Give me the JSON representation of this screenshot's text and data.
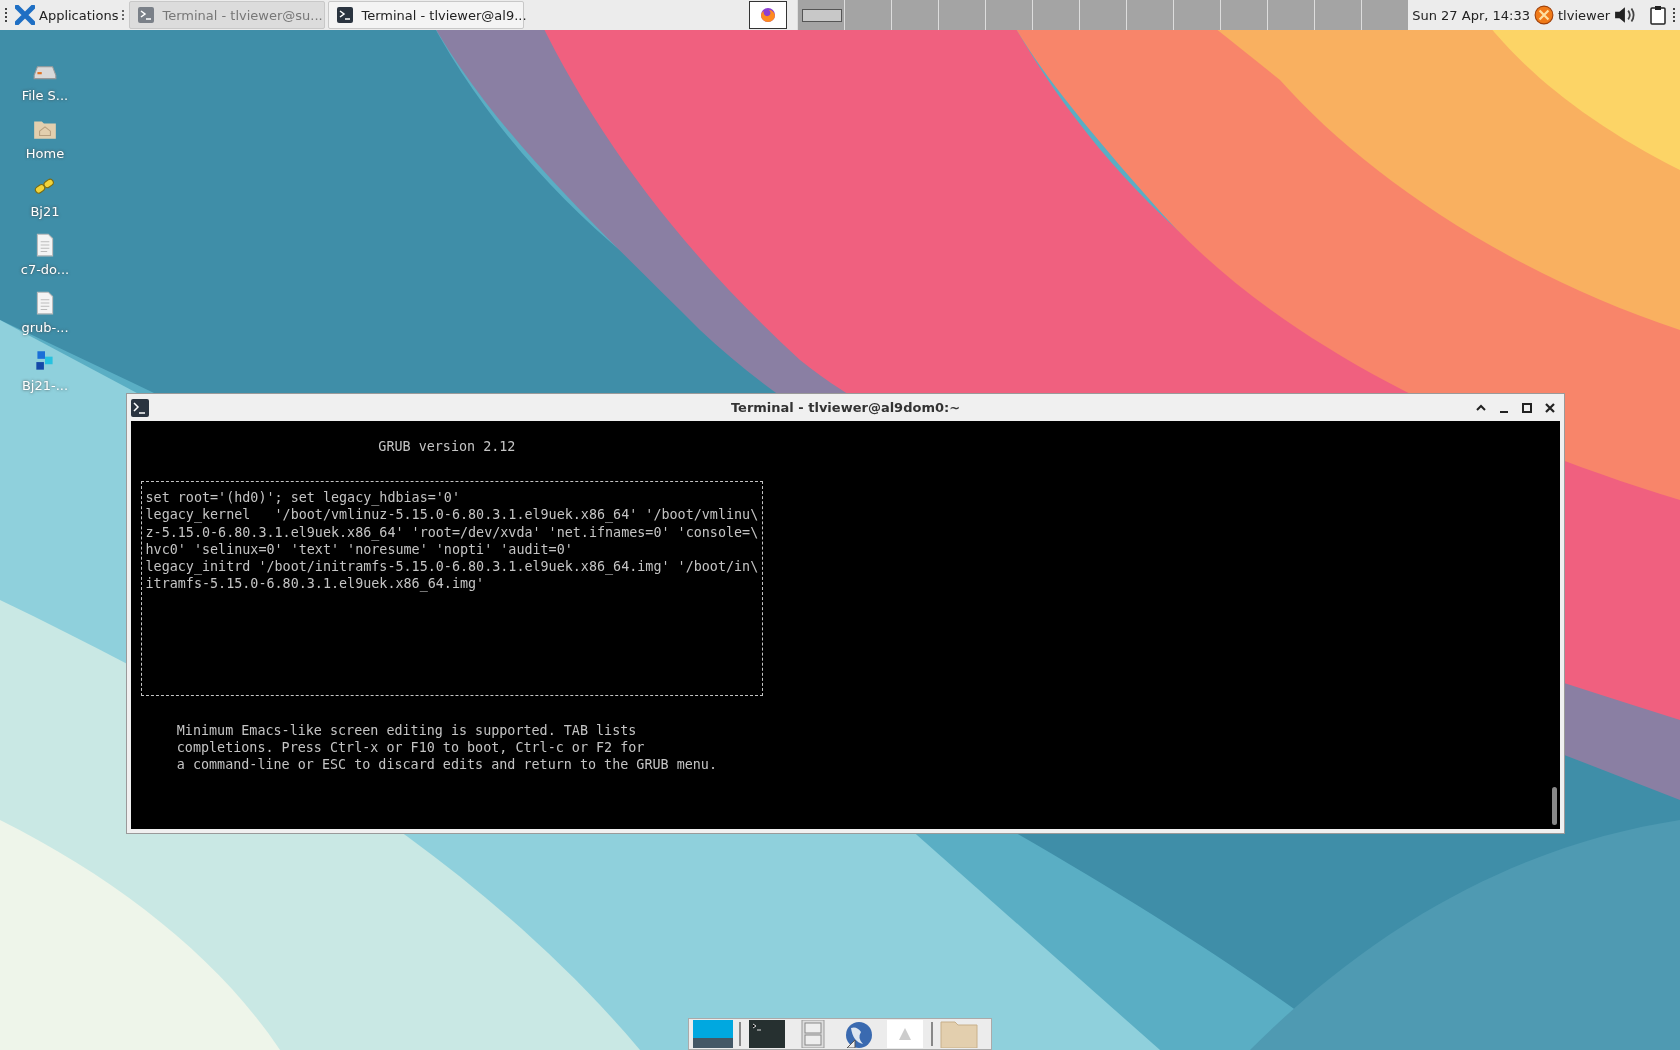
{
  "panel": {
    "apps_menu": "Applications",
    "tasks": [
      {
        "title": "Terminal - tlviewer@su...",
        "selected": false
      },
      {
        "title": "Terminal - tlviewer@al9...",
        "selected": true
      }
    ],
    "workspaces": [
      {
        "has_window": true
      },
      {
        "has_window": false
      },
      {
        "has_window": false
      },
      {
        "has_window": false
      },
      {
        "has_window": false
      },
      {
        "has_window": false
      },
      {
        "has_window": false
      },
      {
        "has_window": false
      },
      {
        "has_window": false
      },
      {
        "has_window": false
      },
      {
        "has_window": false
      },
      {
        "has_window": false
      },
      {
        "has_window": false
      }
    ],
    "clock": "Sun 27 Apr, 14:33",
    "user": "tlviewer"
  },
  "desktop_icons": [
    {
      "label": "File S...",
      "kind": "drive"
    },
    {
      "label": "Home",
      "kind": "home"
    },
    {
      "label": "Bj21",
      "kind": "links"
    },
    {
      "label": "c7-do...",
      "kind": "document"
    },
    {
      "label": "grub-...",
      "kind": "document"
    },
    {
      "label": "Bj21-...",
      "kind": "cubes"
    }
  ],
  "terminal": {
    "title": "Terminal - tlviewer@al9dom0:~",
    "grub_title": "GRUB version 2.12",
    "entry_lines": [
      "set root='(hd0)'; set legacy_hdbias='0'",
      "legacy_kernel   '/boot/vmlinuz-5.15.0-6.80.3.1.el9uek.x86_64' '/boot/vmlinu\\",
      "z-5.15.0-6.80.3.1.el9uek.x86_64' 'root=/dev/xvda' 'net.ifnames=0' 'console=\\",
      "hvc0' 'selinux=0' 'text' 'noresume' 'nopti' 'audit=0'",
      "legacy_initrd '/boot/initramfs-5.15.0-6.80.3.1.el9uek.x86_64.img' '/boot/in\\",
      "itramfs-5.15.0-6.80.3.1.el9uek.x86_64.img'"
    ],
    "help_lines": [
      "Minimum Emacs-like screen editing is supported. TAB lists",
      "completions. Press Ctrl-x or F10 to boot, Ctrl-c or F2 for",
      "a command-line or ESC to discard edits and return to the GRUB menu."
    ]
  },
  "dock": [
    {
      "kind": "desktop"
    },
    {
      "kind": "separator"
    },
    {
      "kind": "terminal"
    },
    {
      "kind": "cabinet"
    },
    {
      "kind": "globe"
    },
    {
      "kind": "warning"
    },
    {
      "kind": "separator"
    },
    {
      "kind": "folder"
    }
  ]
}
